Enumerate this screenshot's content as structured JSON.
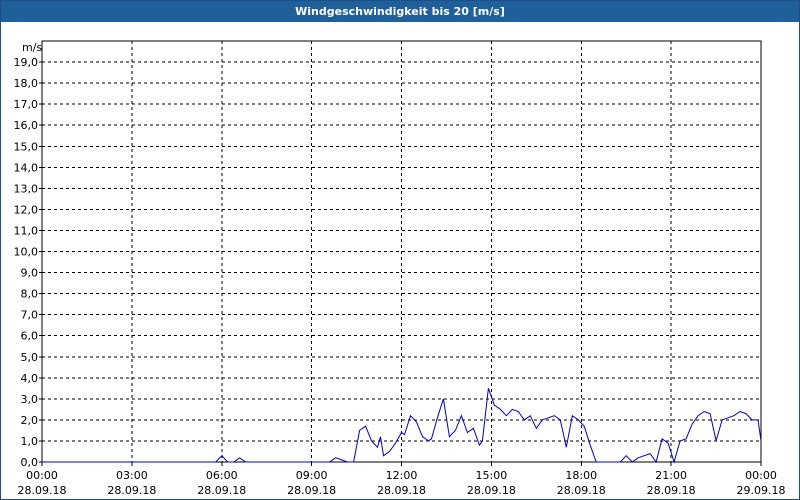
{
  "window": {
    "title": "Windgeschwindigkeit bis 20 [m/s]"
  },
  "colors": {
    "title_bar": "#1f5f9a",
    "series": "#0000c8",
    "grid": "#000000"
  },
  "chart_data": {
    "type": "line",
    "title": "Windgeschwindigkeit bis 20 [m/s]",
    "ylabel": "m/s",
    "xlabel": "",
    "ylim": [
      0,
      20
    ],
    "xlim_hours": [
      0,
      24
    ],
    "grid": true,
    "y_ticks": [
      "0,0",
      "1,0",
      "2,0",
      "3,0",
      "4,0",
      "5,0",
      "6,0",
      "7,0",
      "8,0",
      "9,0",
      "10,0",
      "11,0",
      "12,0",
      "13,0",
      "14,0",
      "15,0",
      "16,0",
      "17,0",
      "18,0",
      "19,0"
    ],
    "x_ticks": [
      {
        "time": "00:00",
        "date": "28.09.18"
      },
      {
        "time": "03:00",
        "date": "28.09.18"
      },
      {
        "time": "06:00",
        "date": "28.09.18"
      },
      {
        "time": "09:00",
        "date": "28.09.18"
      },
      {
        "time": "12:00",
        "date": "28.09.18"
      },
      {
        "time": "15:00",
        "date": "28.09.18"
      },
      {
        "time": "18:00",
        "date": "28.09.18"
      },
      {
        "time": "21:00",
        "date": "28.09.18"
      },
      {
        "time": "00:00",
        "date": "29.09.18"
      }
    ],
    "series": [
      {
        "x": [
          0,
          5.8,
          6.0,
          6.2,
          6.4,
          6.6,
          6.8,
          7.0,
          9.6,
          9.8,
          10.0,
          10.2,
          10.4,
          10.6,
          10.8,
          11.0,
          11.2,
          11.3,
          11.4,
          11.6,
          11.8,
          12.0,
          12.1,
          12.3,
          12.5,
          12.7,
          12.9,
          13.0,
          13.2,
          13.4,
          13.6,
          13.8,
          14.0,
          14.2,
          14.4,
          14.6,
          14.7,
          14.9,
          15.1,
          15.3,
          15.5,
          15.7,
          15.9,
          16.1,
          16.3,
          16.5,
          16.7,
          16.9,
          17.1,
          17.3,
          17.5,
          17.7,
          17.9,
          18.1,
          18.3,
          18.5,
          18.7,
          18.9,
          19.1,
          19.3,
          19.5,
          19.7,
          19.9,
          20.1,
          20.3,
          20.5,
          20.7,
          20.9,
          21.1,
          21.3,
          21.5,
          21.7,
          21.9,
          22.1,
          22.3,
          22.5,
          22.7,
          22.9,
          23.1,
          23.3,
          23.5,
          23.7,
          23.9,
          24.0
        ],
        "y": [
          0,
          0,
          0.3,
          0,
          0,
          0.2,
          0,
          0,
          0,
          0.2,
          0.1,
          0,
          0,
          1.5,
          1.7,
          1.0,
          0.7,
          1.2,
          0.3,
          0.5,
          0.9,
          1.4,
          1.3,
          2.2,
          1.9,
          1.2,
          1.0,
          1.1,
          2.1,
          3.0,
          1.2,
          1.5,
          2.2,
          1.4,
          1.6,
          0.8,
          1.0,
          3.5,
          2.7,
          2.5,
          2.2,
          2.5,
          2.4,
          2.0,
          2.2,
          1.6,
          2.0,
          2.1,
          2.2,
          2.0,
          0.7,
          2.2,
          2.0,
          1.7,
          0.8,
          0,
          0,
          0,
          0,
          0,
          0.3,
          0,
          0.2,
          0.3,
          0.4,
          0,
          1.1,
          0.9,
          0,
          1.0,
          1.1,
          1.8,
          2.2,
          2.4,
          2.3,
          1.0,
          2.0,
          2.1,
          2.2,
          2.4,
          2.3,
          2.0,
          2.0,
          1.0
        ]
      }
    ]
  }
}
